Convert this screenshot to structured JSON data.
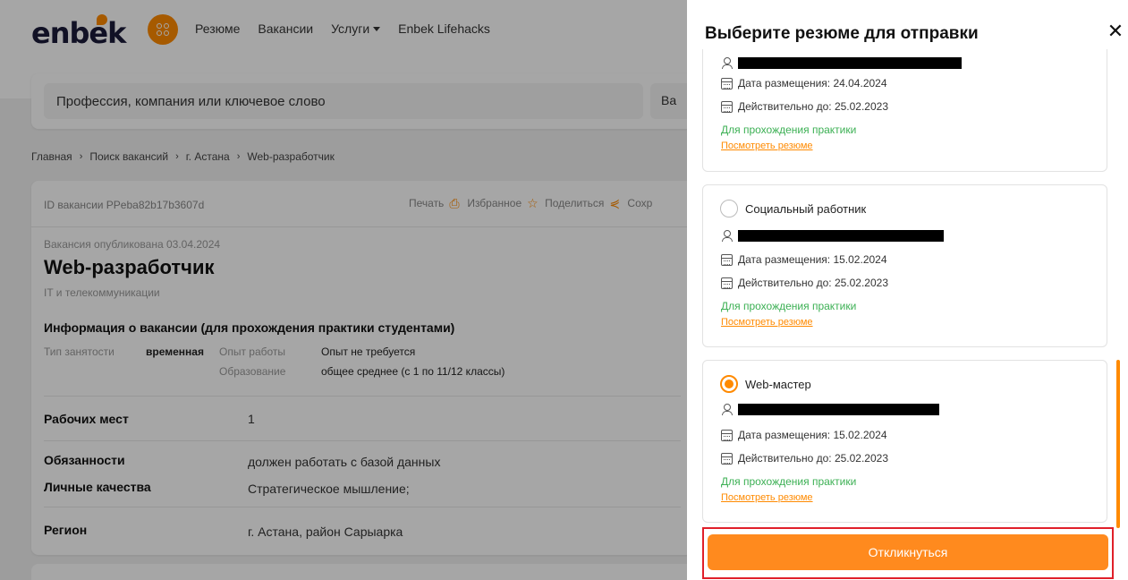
{
  "header": {
    "logo": "enbek",
    "nav": [
      "Резюме",
      "Вакансии",
      "Услуги",
      "Enbek Lifehacks"
    ]
  },
  "search": {
    "placeholder": "Профессия, компания или ключевое слово",
    "region_partial": "Ва"
  },
  "breadcrumb": [
    "Главная",
    "Поиск вакансий",
    "г. Астана",
    "Web-разработчик"
  ],
  "vacancy": {
    "id_text": "ID вакансии PPeba82b17b3607d",
    "actions": [
      "Печать",
      "Избранное",
      "Поделиться",
      "Сохр"
    ],
    "published": "Вакансия опубликована 03.04.2024",
    "title": "Web-разработчик",
    "category": "IT и телекоммуникации",
    "info_title": "Информация о вакансии (для прохождения практики студентами)",
    "employment_label": "Тип занятости",
    "employment_value": "временная",
    "experience_label": "Опыт работы",
    "experience_value": "Опыт не требуется",
    "education_label": "Образование",
    "education_value": "общее среднее (с 1 по 11/12 классы)",
    "fields": [
      {
        "label": "Рабочих мест",
        "value": "1"
      },
      {
        "label": "Обязанности",
        "value": "должен работать с базой данных"
      },
      {
        "label": "Личные качества",
        "value": "Стратегическое мышление;"
      },
      {
        "label": "Регион",
        "value": "г. Астана, район Сарыарка"
      }
    ]
  },
  "panel": {
    "title": "Выберите резюме для отправки",
    "resumes": [
      {
        "title": "",
        "posted": "Дата размещения: 24.04.2024",
        "valid": "Действительно до: 25.02.2023",
        "practice": "Для прохождения практики",
        "link": "Посмотреть резюме",
        "selected": false
      },
      {
        "title": "Социальный работник",
        "posted": "Дата размещения: 15.02.2024",
        "valid": "Действительно до: 25.02.2023",
        "practice": "Для прохождения практики",
        "link": "Посмотреть резюме",
        "selected": false
      },
      {
        "title": "Web-мастер",
        "posted": "Дата размещения: 15.02.2024",
        "valid": "Действительно до: 25.02.2023",
        "practice": "Для прохождения практики",
        "link": "Посмотреть резюме",
        "selected": true
      }
    ],
    "respond_label": "Откликнуться"
  },
  "colors": {
    "accent": "#ff8a00",
    "practice_green": "#3cb054",
    "highlight_red": "#e0202a"
  }
}
